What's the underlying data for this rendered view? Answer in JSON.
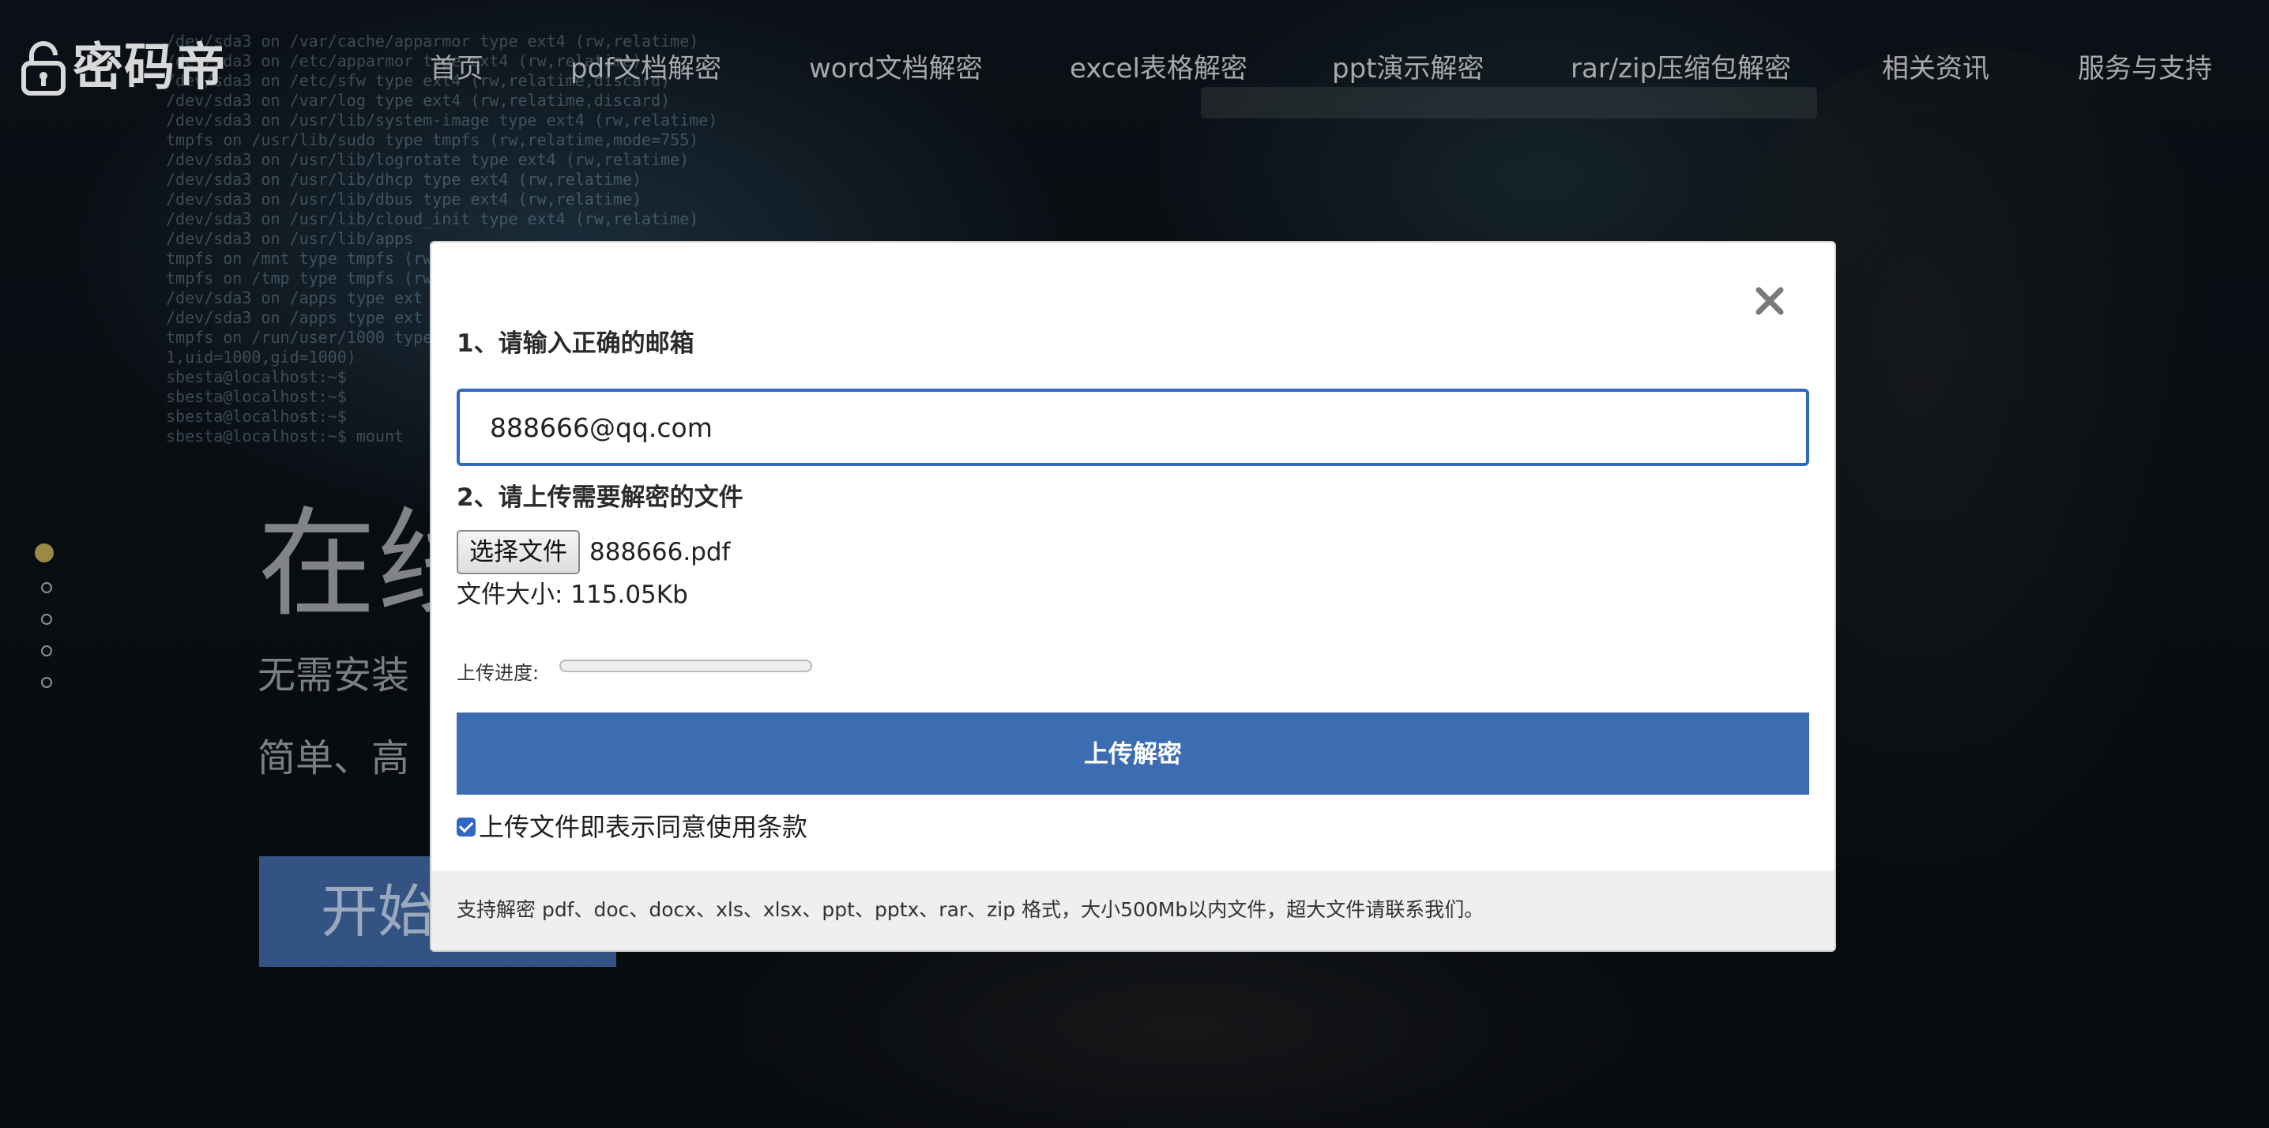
{
  "logo": {
    "text": "密码帝"
  },
  "nav": {
    "items": [
      {
        "label": "首页"
      },
      {
        "label": "pdf文档解密"
      },
      {
        "label": "word文档解密"
      },
      {
        "label": "excel表格解密"
      },
      {
        "label": "ppt演示解密"
      },
      {
        "label": "rar/zip压缩包解密"
      },
      {
        "label": "相关资讯"
      },
      {
        "label": "服务与支持"
      }
    ]
  },
  "carousel": {
    "slides": 5,
    "active_index": 0,
    "active_color": "#9a8a46"
  },
  "hero": {
    "title": "在线",
    "line1": "无需安装",
    "line2": "简单、高",
    "button_label": "开始"
  },
  "modal": {
    "step1_label": "1、请输入正确的邮箱",
    "email_value": "888666@qq.com",
    "step2_label": "2、请上传需要解密的文件",
    "choose_file_label": "选择文件",
    "file_name": "888666.pdf",
    "file_size": "文件大小: 115.05Kb",
    "progress_label": "上传进度:",
    "progress_value": 0,
    "submit_label": "上传解密",
    "agree_checked": true,
    "agree_label": "上传文件即表示同意使用条款",
    "note": "支持解密 pdf、doc、docx、xls、xlsx、ppt、pptx、rar、zip 格式，大小500Mb以内文件，超大文件请联系我们。"
  },
  "colors": {
    "accent": "#3c6cb2",
    "focus_border": "#2f67c4",
    "nav_text": "#a9a9a9"
  }
}
